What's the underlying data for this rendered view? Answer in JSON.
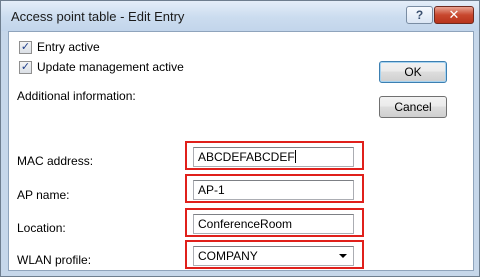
{
  "window": {
    "title": "Access point table - Edit Entry"
  },
  "titlebar_buttons": {
    "help": "?",
    "close": "✕"
  },
  "checkboxes": [
    {
      "label": "Entry active",
      "checked": true
    },
    {
      "label": "Update management active",
      "checked": true
    }
  ],
  "section_label": "Additional information:",
  "buttons": {
    "ok": "OK",
    "cancel": "Cancel"
  },
  "fields": {
    "mac": {
      "label": "MAC address:",
      "value": "ABCDEFABCDEF"
    },
    "ap_name": {
      "label": "AP name:",
      "value": "AP-1"
    },
    "location": {
      "label": "Location:",
      "value": "ConferenceRoom"
    },
    "wlan_profile": {
      "label": "WLAN profile:",
      "value": "COMPANY"
    }
  },
  "checkmark": "✓",
  "colors": {
    "highlight_border": "#e0201b",
    "title_bg": "#cbdcef",
    "close_button": "#c8472e"
  }
}
